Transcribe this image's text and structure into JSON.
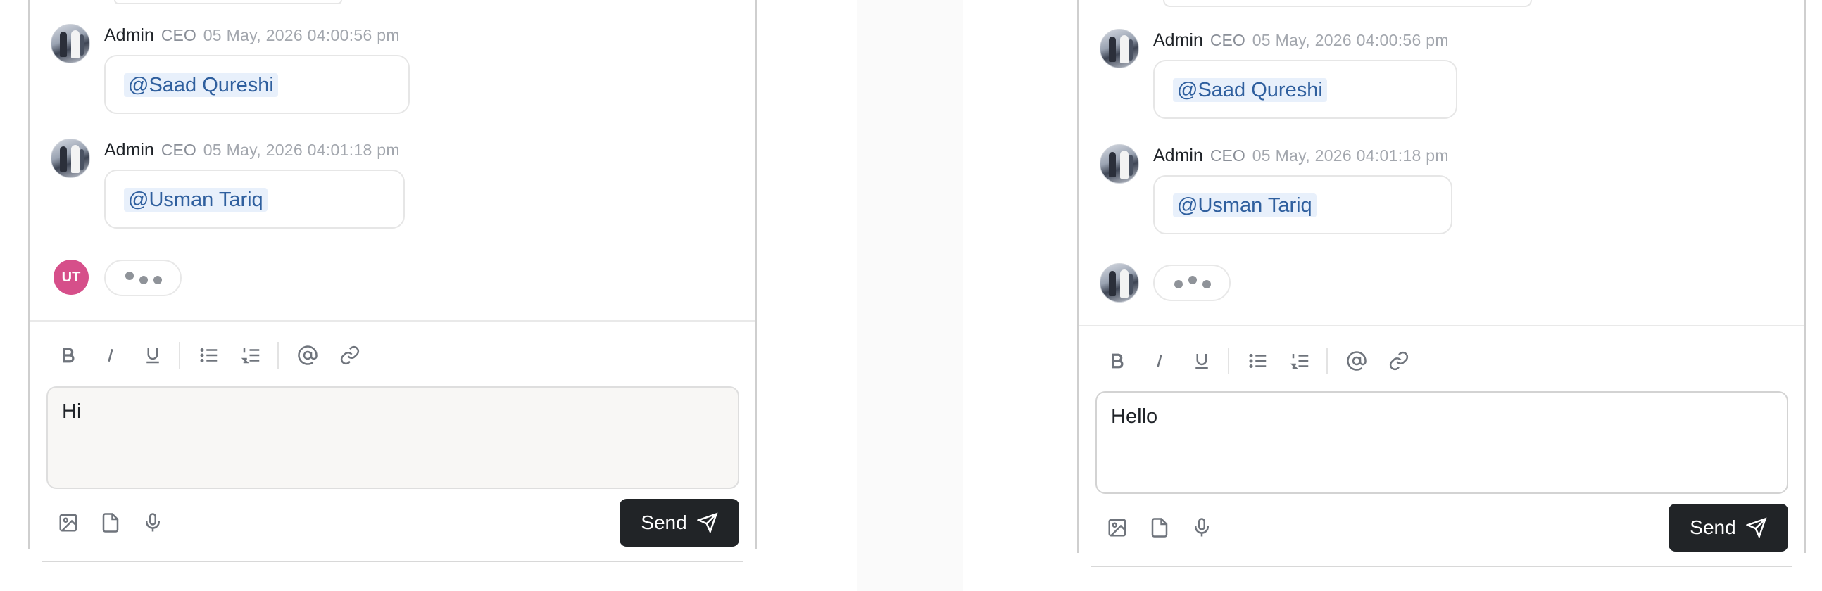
{
  "panels": [
    {
      "messages": [
        {
          "name": "Admin",
          "role": "CEO",
          "time": "05 May, 2026 04:00:56 pm",
          "mention": "@Saad Qureshi"
        },
        {
          "name": "Admin",
          "role": "CEO",
          "time": "05 May, 2026 04:01:18 pm",
          "mention": "@Usman Tariq"
        }
      ],
      "typing_initials": "UT",
      "editor_value": "Hi",
      "send_label": "Send"
    },
    {
      "messages": [
        {
          "name": "Admin",
          "role": "CEO",
          "time": "05 May, 2026 04:00:56 pm",
          "mention": "@Saad Qureshi"
        },
        {
          "name": "Admin",
          "role": "CEO",
          "time": "05 May, 2026 04:01:18 pm",
          "mention": "@Usman Tariq"
        }
      ],
      "editor_value": "Hello",
      "send_label": "Send"
    }
  ],
  "toolbar_icons": [
    "bold-icon",
    "italic-icon",
    "underline-icon",
    "bullet-list-icon",
    "numbered-list-icon",
    "mention-icon",
    "link-icon"
  ],
  "attach_icons": [
    "image-icon",
    "file-icon",
    "microphone-icon"
  ],
  "colors": {
    "send_button": "#212427",
    "mention_bg": "#e8f0fb",
    "mention_text": "#2f5f9e",
    "typing_avatar": "#d64f8a"
  }
}
